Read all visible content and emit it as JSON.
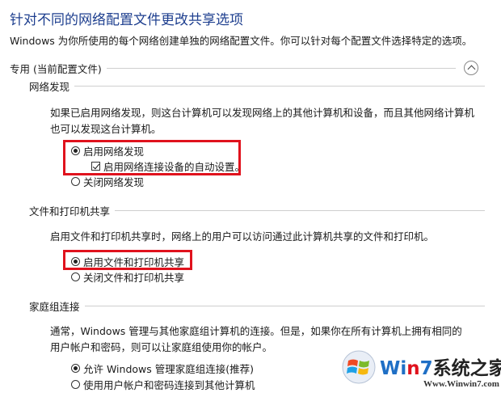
{
  "page": {
    "title": "针对不同的网络配置文件更改共享选项",
    "description": "Windows 为你所使用的每个网络创建单独的网络配置文件。你可以针对每个配置文件选择特定的选项。"
  },
  "profile": {
    "header": "专用 (当前配置文件)",
    "collapse_icon": "chevron-up-icon"
  },
  "network_discovery": {
    "header": "网络发现",
    "description": "如果已启用网络发现，则这台计算机可以发现网络上的其他计算机和设备，而且其他网络计算机也可以发现这台计算机。",
    "on_label": "启用网络发现",
    "auto_setup_label": "启用网络连接设备的自动设置。",
    "off_label": "关闭网络发现",
    "selected": "on",
    "auto_setup_checked": true
  },
  "file_sharing": {
    "header": "文件和打印机共享",
    "description": "启用文件和打印机共享时，网络上的用户可以访问通过此计算机共享的文件和打印机。",
    "on_label": "启用文件和打印机共享",
    "off_label": "关闭文件和打印机共享",
    "selected": "on"
  },
  "homegroup": {
    "header": "家庭组连接",
    "description": "通常，Windows 管理与其他家庭组计算机的连接。但是，如果你在所有计算机上拥有相同的用户帐户和密码，则可以让家庭组使用你的帐户。",
    "allow_label": "允许 Windows 管理家庭组连接(推荐)",
    "manual_label": "使用用户帐户和密码连接到其他计算机",
    "selected": "allow"
  },
  "watermark": {
    "brand": "Win7系统之家",
    "brand_win": "Wi",
    "brand_n": "n",
    "brand_7": "7",
    "brand_rest": "系统之家",
    "url": "Www.Winwin7.com"
  },
  "colors": {
    "title": "#1e3f8f",
    "highlight_border": "#e0121d"
  }
}
